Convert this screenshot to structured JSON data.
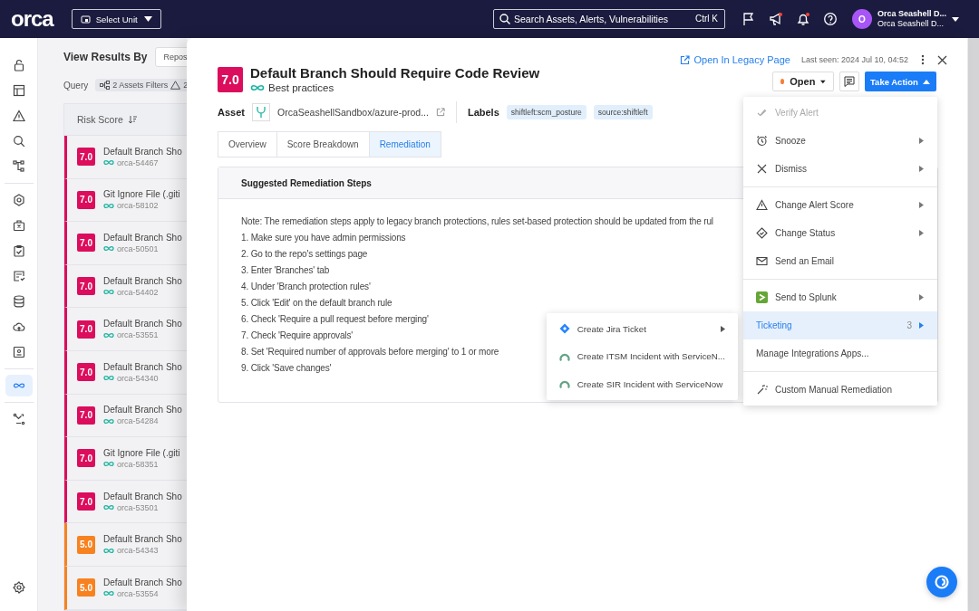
{
  "topbar": {
    "logo": "orca",
    "unit_select": "Select Unit",
    "search": {
      "placeholder": "Search Assets, Alerts, Vulnerabilities",
      "shortcut": "Ctrl K"
    },
    "icons": [
      {
        "kind": "flag",
        "badge": false
      },
      {
        "kind": "megaphone",
        "badge": true
      },
      {
        "kind": "bell",
        "badge": true
      },
      {
        "kind": "help",
        "badge": false
      }
    ],
    "user": {
      "initial": "O",
      "name": "Orca Seashell D...",
      "org": "Orca Seashell D..."
    }
  },
  "rail": {
    "groups": [
      [
        {
          "kind": "lock",
          "selected": false
        },
        {
          "kind": "layout",
          "selected": false
        },
        {
          "kind": "alert",
          "selected": false
        },
        {
          "kind": "search",
          "selected": false
        },
        {
          "kind": "graph",
          "selected": false
        }
      ],
      [
        {
          "kind": "shield",
          "selected": false
        },
        {
          "kind": "briefcase",
          "selected": false
        },
        {
          "kind": "clipboard",
          "selected": false
        },
        {
          "kind": "document",
          "selected": false
        },
        {
          "kind": "database",
          "selected": false
        },
        {
          "kind": "cloud",
          "selected": false
        },
        {
          "kind": "idcard",
          "selected": false
        }
      ],
      [
        {
          "kind": "infinity",
          "selected": true
        }
      ],
      [
        {
          "kind": "workflow",
          "selected": false
        }
      ]
    ]
  },
  "results": {
    "title": "View Results By",
    "view_button": "Repos",
    "query_label": "Query",
    "filters": [
      {
        "kind": "assets",
        "label": "2 Assets Filters"
      },
      {
        "kind": "alerts",
        "label": "2"
      }
    ],
    "column": "Risk Score",
    "rows": [
      {
        "score": "7.0",
        "color": "#dc0d5c",
        "title": "Default Branch Sho",
        "id": "orca-54467"
      },
      {
        "score": "7.0",
        "color": "#dc0d5c",
        "title": "Git Ignore File (.giti",
        "id": "orca-58102"
      },
      {
        "score": "7.0",
        "color": "#dc0d5c",
        "title": "Default Branch Sho",
        "id": "orca-50501"
      },
      {
        "score": "7.0",
        "color": "#dc0d5c",
        "title": "Default Branch Sho",
        "id": "orca-54402"
      },
      {
        "score": "7.0",
        "color": "#dc0d5c",
        "title": "Default Branch Sho",
        "id": "orca-53551"
      },
      {
        "score": "7.0",
        "color": "#dc0d5c",
        "title": "Default Branch Sho",
        "id": "orca-54340"
      },
      {
        "score": "7.0",
        "color": "#dc0d5c",
        "title": "Default Branch Sho",
        "id": "orca-54284"
      },
      {
        "score": "7.0",
        "color": "#dc0d5c",
        "title": "Git Ignore File (.giti",
        "id": "orca-58351"
      },
      {
        "score": "7.0",
        "color": "#dc0d5c",
        "title": "Default Branch Sho",
        "id": "orca-53501"
      },
      {
        "score": "5.0",
        "color": "#f7821f",
        "title": "Default Branch Sho",
        "id": "orca-54343"
      },
      {
        "score": "5.0",
        "color": "#f7821f",
        "title": "Default Branch Sho",
        "id": "orca-53554"
      }
    ]
  },
  "alert": {
    "legacy_link": "Open In Legacy Page",
    "last_seen": "Last seen: 2024 Jul 10, 04:52",
    "score": "7.0",
    "color": "#dc0d5c",
    "title": "Default Branch Should Require Code Review",
    "category": "Best practices",
    "status": {
      "label": "Open",
      "color": "#f5813a"
    },
    "take_action": {
      "label": "Take Action",
      "expanded": true
    },
    "asset_label": "Asset",
    "asset": "OrcaSeashellSandbox/azure-prod...",
    "labels_label": "Labels",
    "labels": [
      "shiftleft:scm_posture",
      "source:shiftleft"
    ],
    "tabs": [
      {
        "label": "Overview",
        "selected": false
      },
      {
        "label": "Score Breakdown",
        "selected": false
      },
      {
        "label": "Remediation",
        "selected": true
      }
    ],
    "remediation": {
      "title": "Suggested Remediation Steps",
      "lines": [
        "Note: The remediation steps apply to legacy branch protections, rules set-based protection should be updated from the rul",
        "1. Make sure you have admin permissions",
        "2. Go to the repo's settings page",
        "3. Enter 'Branches' tab",
        "4. Under 'Branch protection rules'",
        "5. Click 'Edit' on the default branch rule",
        "6. Check 'Require a pull request before merging'",
        "7. Check 'Require approvals'",
        "8. Set 'Required number of approvals before merging' to 1 or more",
        "9. Click 'Save changes'"
      ]
    }
  },
  "action_menu": {
    "groups": [
      [
        {
          "label": "Verify Alert",
          "kind": "check",
          "disabled": true,
          "submenu": false,
          "selected": false
        },
        {
          "label": "Snooze",
          "kind": "alarm",
          "disabled": false,
          "submenu": true,
          "selected": false
        },
        {
          "label": "Dismiss",
          "kind": "x",
          "disabled": false,
          "submenu": true,
          "selected": false
        }
      ],
      [
        {
          "label": "Change Alert Score",
          "kind": "warning",
          "disabled": false,
          "submenu": true,
          "selected": false
        },
        {
          "label": "Change Status",
          "kind": "status",
          "disabled": false,
          "submenu": true,
          "selected": false
        },
        {
          "label": "Send an Email",
          "kind": "mail",
          "disabled": false,
          "submenu": false,
          "selected": false
        }
      ],
      [
        {
          "label": "Send to Splunk",
          "kind": "splunk",
          "disabled": false,
          "submenu": true,
          "selected": false
        },
        {
          "label": "Ticketing",
          "count": "3",
          "disabled": false,
          "submenu": true,
          "selected": true
        },
        {
          "label": "Manage Integrations Apps...",
          "disabled": false,
          "submenu": false,
          "selected": false
        }
      ],
      [
        {
          "label": "Custom Manual Remediation",
          "kind": "wand",
          "disabled": false,
          "submenu": false,
          "selected": false
        }
      ]
    ]
  },
  "ticket_menu": [
    {
      "label": "Create Jira Ticket",
      "kind": "jira",
      "submenu": true
    },
    {
      "label": "Create ITSM Incident with ServiceN...",
      "kind": "servicenow",
      "submenu": false
    },
    {
      "label": "Create SIR Incident with ServiceNow",
      "kind": "servicenow",
      "submenu": false
    }
  ]
}
